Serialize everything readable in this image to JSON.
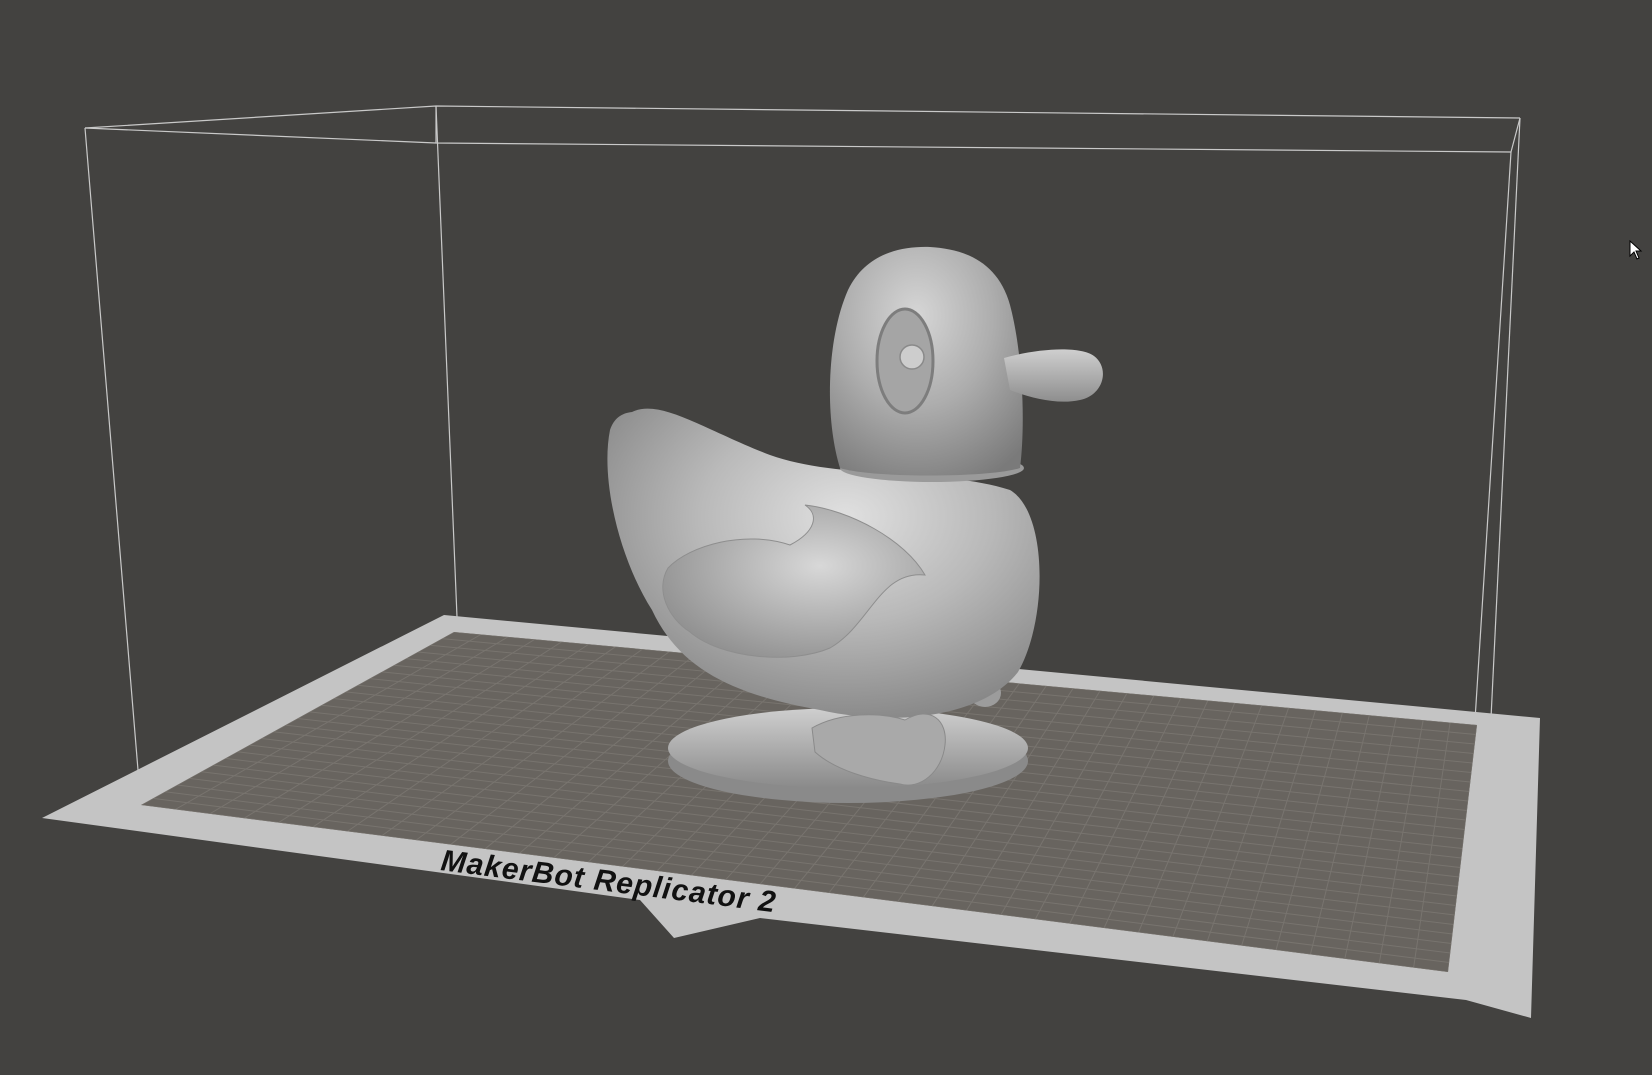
{
  "viewport": {
    "printer_name": "MakerBot Replicator 2",
    "model_icon": "duck-model",
    "cursor_icon": "arrow-cursor-icon",
    "colors": {
      "background": "#434240",
      "build_volume_lines": "#d8d8d8",
      "plate_border": "#c4c4c4",
      "plate_surface": "#68645f",
      "grid_lines": "#7a7671",
      "model": "#b4b4b4"
    }
  }
}
